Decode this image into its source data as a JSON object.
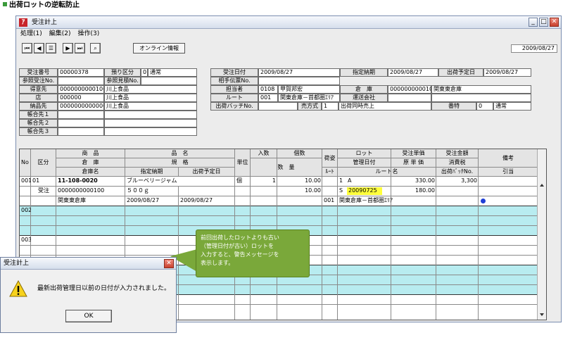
{
  "caption": "出荷ロットの逆転防止",
  "window": {
    "title": "受注計上",
    "menu": [
      "処理(1)",
      "編集(2)",
      "操作(3)"
    ],
    "toolbar_icons": [
      "first-icon",
      "prev-icon",
      "list-icon",
      "next-icon",
      "last-icon",
      "search-icon"
    ],
    "online_label": "オンライン情報",
    "date": "2009/08/27"
  },
  "header_left": {
    "order_no_label": "受注番号",
    "order_no": "00000378",
    "deposit_label": "預り区分",
    "deposit_code": "0",
    "deposit_name": "通常",
    "ref_order_label": "参照受注No.",
    "ref_quote_label": "参照見積No.",
    "customer_label": "得意先",
    "customer_code": "0000000000100",
    "customer_name": "川上食品",
    "store_label": "店",
    "store_code": "000000",
    "store_name": "川上食品",
    "delivery_label": "納品先",
    "delivery_code": "0000000000000",
    "delivery_name": "川上食品",
    "ledger1_label": "帳合先１",
    "ledger2_label": "帳合先２",
    "ledger3_label": "帳合先３"
  },
  "header_right": {
    "order_date_label": "受注日付",
    "order_date": "2009/08/27",
    "due_label": "指定納期",
    "due": "2009/08/27",
    "ship_plan_label": "出荷予定日",
    "ship_plan": "2009/08/27",
    "partner_slip_label": "相手伝票No.",
    "staff_label": "担当者",
    "staff_code": "0108",
    "staff_name": "甲賀邦宏",
    "warehouse_label": "倉　庫",
    "warehouse_code": "0000000000100",
    "warehouse_name": "関東東倉庫",
    "route_label": "ルート",
    "route_code": "001",
    "route_name": "関東倉庫－首都圏ｴﾘｱ",
    "carrier_label": "運送会社",
    "batch_label": "出荷バッチNo.",
    "sale_type_label": "売方式",
    "sale_type_code": "1",
    "sale_type_name": "出荷同時売上",
    "special_label": "番特",
    "special_code": "0",
    "special_name": "通常"
  },
  "grid_header": {
    "no": "No",
    "kubun": "区分",
    "product": "商　品",
    "warehouse": "倉　庫",
    "warehouse_name": "倉庫名",
    "item_name": "品　名",
    "spec": "規　格",
    "due": "指定納期",
    "ship_plan": "出荷予定日",
    "unit": "単位",
    "irisu": "入数",
    "kosu": "個数",
    "qty": "数　量",
    "nisugata": "荷姿",
    "route_short": "ﾙｰﾄ",
    "lot": "ロット",
    "mgmt_date": "管理日付",
    "route_name": "ルート名",
    "unit_price": "受注単価",
    "cost_price": "原 単 価",
    "amount": "受注金額",
    "tax": "消費税",
    "batch": "出荷ﾊﾞｯﾁNo.",
    "remarks": "備考",
    "allocation": "引当"
  },
  "rows": [
    {
      "no": "001",
      "kubun_code": "01",
      "kubun_name": "受注",
      "product_code": "11-108-0020",
      "item_name": "ブルーベリージャム",
      "warehouse_code": "0000000000100",
      "spec": "５００ｇ",
      "warehouse_name": "関東東倉庫",
      "due": "2009/08/27",
      "ship_plan": "2009/08/27",
      "unit": "個",
      "irisu": "1",
      "kosu": "10.00",
      "qty": "10.00",
      "route_code": "001",
      "lot_code": "1",
      "lot_name": "A",
      "mgmt_prefix": "S",
      "mgmt_date": "20090725",
      "route_name": "関東倉庫－首都圏ｴﾘｱ",
      "unit_price": "330.00",
      "cost_price": "180.00",
      "amount": "3,300"
    },
    {
      "no": "002"
    },
    {
      "no": "003"
    }
  ],
  "callout": [
    "前回出荷したロットよりも古い",
    "（管理日付が古い）ロットを",
    "入力すると、警告メッセージを",
    "表示します。"
  ],
  "dialog": {
    "title": "受注計上",
    "message": "最新出荷管理日以前の日付が入力されました。",
    "ok": "OK"
  }
}
